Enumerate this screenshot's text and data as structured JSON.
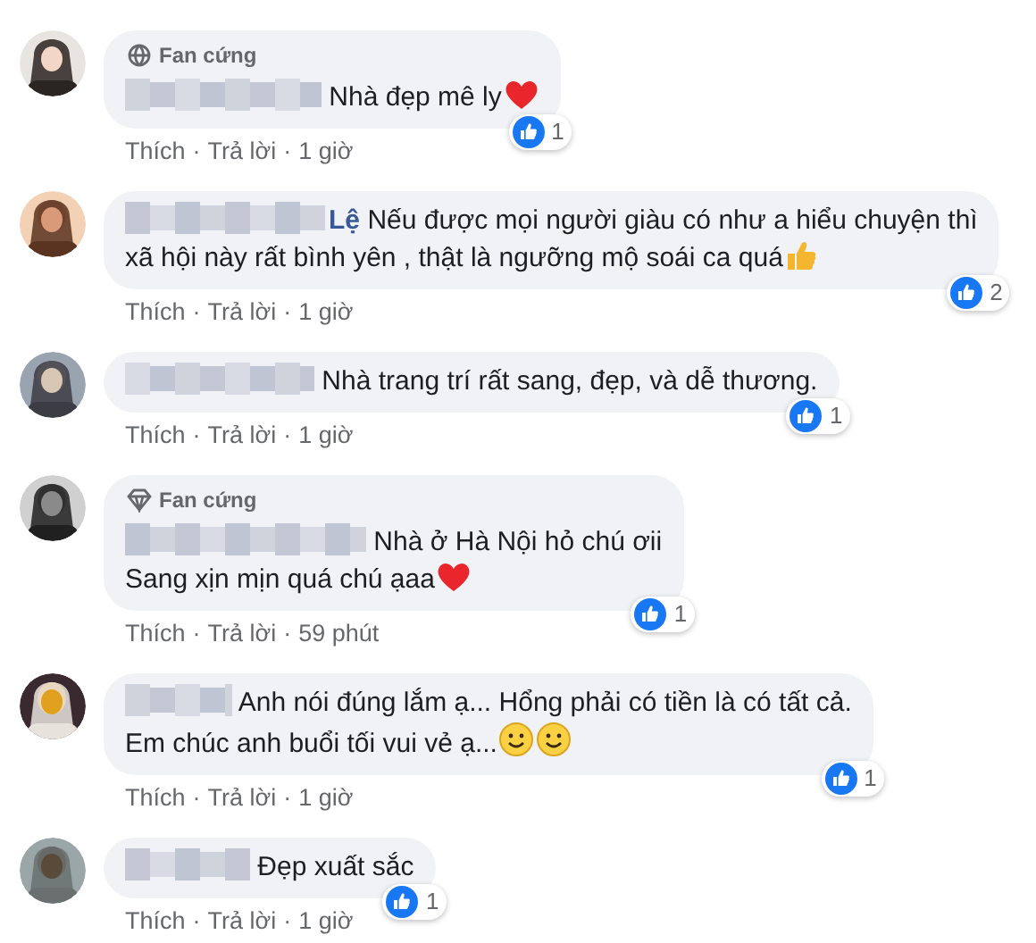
{
  "comments": [
    {
      "badge": {
        "label": "Fan cứng",
        "kind": "globe"
      },
      "lines": [
        "Nhà đẹp mê ly"
      ],
      "trailing_icons": [
        {
          "kind": "heart"
        }
      ],
      "likes": "1",
      "actions": [
        "Thích",
        "·",
        "Trả lời",
        "·",
        "1 giờ"
      ]
    },
    {
      "name_tail": "Lệ",
      "lines": [
        "Nếu được mọi người giàu có như a hiểu chuyện thì",
        "xã hội này rất bình yên , thật là ngưỡng mộ soái ca quá"
      ],
      "trailing_icons": [
        {
          "kind": "thumb"
        }
      ],
      "likes": "2",
      "actions": [
        "Thích",
        "·",
        "Trả lời",
        "·",
        "1 giờ"
      ]
    },
    {
      "lines": [
        "Nhà trang trí rất sang, đẹp, và dễ thương."
      ],
      "likes": "1",
      "actions": [
        "Thích",
        "·",
        "Trả lời",
        "·",
        "1 giờ"
      ]
    },
    {
      "badge": {
        "label": "Fan cứng",
        "kind": "diamond"
      },
      "lines": [
        "Nhà ở Hà Nội hỏ chú ơii",
        "Sang xịn mịn quá chú ạaa"
      ],
      "trailing_icons": [
        {
          "kind": "heart"
        }
      ],
      "likes": "1",
      "actions": [
        "Thích",
        "·",
        "Trả lời",
        "·",
        "59 phút"
      ]
    },
    {
      "lines": [
        "Anh nói đúng lắm ạ... Hổng phải có tiền là có tất cả.",
        "Em chúc anh buổi tối vui vẻ ạ..."
      ],
      "trailing_icons": [
        {
          "kind": "smiley"
        },
        {
          "kind": "smiley"
        }
      ],
      "likes": "1",
      "actions": [
        "Thích",
        "·",
        "Trả lời",
        "·",
        "1 giờ"
      ]
    },
    {
      "lines": [
        "Đẹp xuất sắc"
      ],
      "likes": "1",
      "actions": [
        "Thích",
        "·",
        "Trả lời",
        "·",
        "1 giờ"
      ]
    }
  ]
}
